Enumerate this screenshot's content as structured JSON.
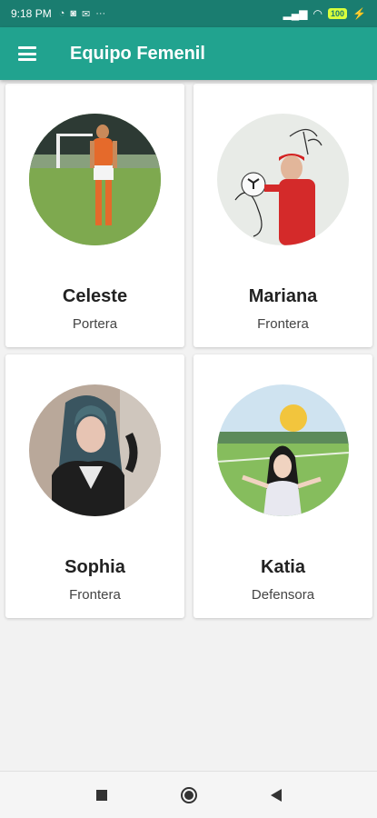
{
  "status_bar": {
    "time": "9:18 PM",
    "icons": [
      "whatsapp-icon",
      "game-icon",
      "mail-icon",
      "more-icon"
    ],
    "battery": "100"
  },
  "app_bar": {
    "title": "Equipo Femenil",
    "menu_icon": "hamburger-menu-icon",
    "color": "#21a38f"
  },
  "players": [
    {
      "name": "Celeste",
      "role": "Portera",
      "photo": "celeste-photo"
    },
    {
      "name": "Mariana",
      "role": "Frontera",
      "photo": "mariana-photo"
    },
    {
      "name": "Sophia",
      "role": "Frontera",
      "photo": "sophia-photo"
    },
    {
      "name": "Katia",
      "role": "Defensora",
      "photo": "katia-photo"
    }
  ],
  "nav_bar": {
    "buttons": [
      "recents-square-icon",
      "home-circle-icon",
      "back-triangle-icon"
    ]
  }
}
